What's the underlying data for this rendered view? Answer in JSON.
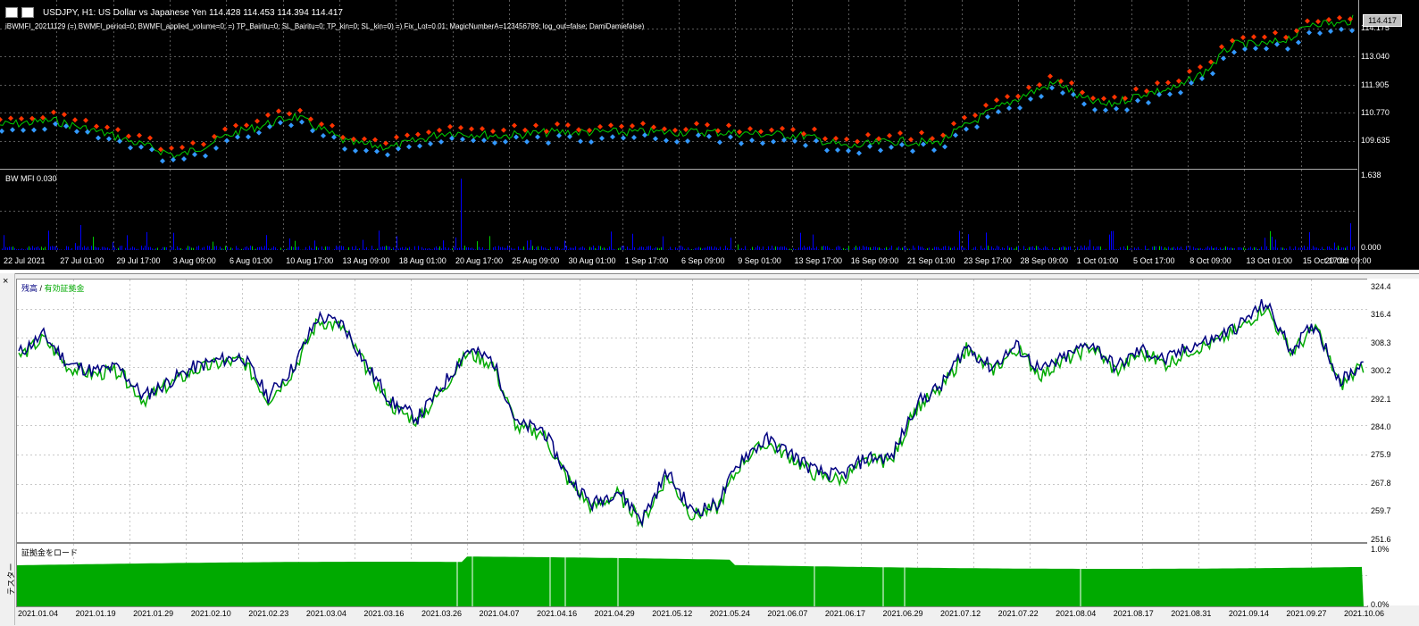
{
  "price_chart": {
    "symbol_header": "USDJPY, H1:  US Dollar vs Japanese Yen  114.428 114.453 114.394 114.417",
    "ea_params": "iBWMFI_20211129 (=) BWMFI_period=0; BWMFI_applied_volume=0; =) TP_Bairitu=0; SL_Bairitu=0; TP_kin=0; SL_kin=0) =) Fix_Lot=0.01; MagicNumberA=123456789; log_out=false; DamiDamiefalse)",
    "last_price": "114.417",
    "price_ticks": [
      "114.175",
      "113.040",
      "111.905",
      "110.770",
      "109.635"
    ],
    "mfi_label": "BW MFI 0.030",
    "mfi_ticks": [
      "1.638",
      "0.000"
    ],
    "x_ticks": [
      "22 Jul 2021",
      "27 Jul 01:00",
      "29 Jul 17:00",
      "3 Aug 09:00",
      "6 Aug 01:00",
      "10 Aug 17:00",
      "13 Aug 09:00",
      "18 Aug 01:00",
      "20 Aug 17:00",
      "25 Aug 09:00",
      "30 Aug 01:00",
      "1 Sep 17:00",
      "6 Sep 09:00",
      "9 Sep 01:00",
      "13 Sep 17:00",
      "16 Sep 09:00",
      "21 Sep 01:00",
      "23 Sep 17:00",
      "28 Sep 09:00",
      "1 Oct 01:00",
      "5 Oct 17:00",
      "8 Oct 09:00",
      "13 Oct 01:00",
      "15 Oct 17:00",
      "20 Oct 09:00"
    ],
    "colors": {
      "background": "#000000",
      "price_line": "#00cc00",
      "sell_marker": "#ff3300",
      "buy_marker": "#3399ff",
      "mfi_bar": "#0000ff"
    }
  },
  "tester": {
    "close_glyph": "×",
    "side_caption": "テスター",
    "balance_label": "残高",
    "separator": " / ",
    "equity_label": "有効証拠金",
    "load_label": "証拠金をロード",
    "right_ticks": [
      "324.4",
      "316.4",
      "308.3",
      "300.2",
      "292.1",
      "284.0",
      "275.9",
      "267.8",
      "259.7",
      "251.6"
    ],
    "load_ticks": [
      "1.0%",
      "0.0%"
    ],
    "x_ticks": [
      "2021.01.04",
      "2021.01.19",
      "2021.01.29",
      "2021.02.10",
      "2021.02.23",
      "2021.03.04",
      "2021.03.16",
      "2021.03.26",
      "2021.04.07",
      "2021.04.16",
      "2021.04.29",
      "2021.05.12",
      "2021.05.24",
      "2021.06.07",
      "2021.06.17",
      "2021.06.29",
      "2021.07.12",
      "2021.07.22",
      "2021.08.04",
      "2021.08.17",
      "2021.08.31",
      "2021.09.14",
      "2021.09.27",
      "2021.10.06"
    ],
    "colors": {
      "balance": "#000080",
      "equity": "#00aa00",
      "load_fill": "#00aa00"
    }
  },
  "chart_data": [
    {
      "type": "line",
      "series": [
        {
          "name": "残高",
          "values": [
            304,
            309,
            301,
            299,
            300,
            292,
            296,
            300,
            302,
            303,
            292,
            300,
            314,
            312,
            300,
            290,
            286,
            295,
            305,
            302,
            284,
            283,
            270,
            262,
            266,
            258,
            271,
            260,
            262,
            275,
            280,
            276,
            271,
            270,
            275,
            275,
            290,
            295,
            306,
            300,
            306,
            299,
            303,
            307,
            300,
            305,
            302,
            306,
            308,
            312,
            318,
            305,
            312,
            296,
            302
          ]
        },
        {
          "name": "有効証拠金",
          "values": [
            303,
            308,
            300,
            298,
            299,
            291,
            295,
            299,
            301,
            302,
            291,
            299,
            313,
            311,
            299,
            289,
            285,
            294,
            304,
            301,
            283,
            282,
            269,
            261,
            265,
            257,
            270,
            259,
            261,
            274,
            279,
            275,
            270,
            269,
            274,
            274,
            289,
            294,
            305,
            299,
            305,
            298,
            302,
            306,
            299,
            304,
            301,
            305,
            307,
            311,
            317,
            304,
            311,
            295,
            301
          ]
        }
      ],
      "ylim": [
        251.6,
        324.4
      ]
    }
  ]
}
